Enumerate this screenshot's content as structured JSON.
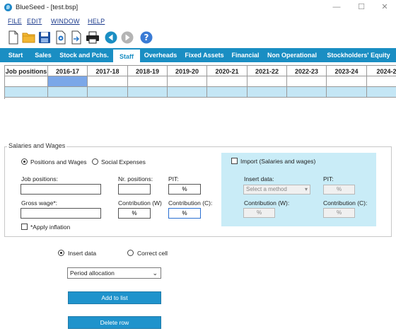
{
  "window": {
    "title": "BlueSeed - [test.bsp]",
    "minimize_icon": "minimize-icon",
    "maximize_icon": "maximize-icon",
    "close_icon": "close-icon"
  },
  "menu": [
    "FILE",
    "EDIT",
    "WINDOW",
    "HELP"
  ],
  "toolbar": {
    "icons": [
      "new-file-icon",
      "open-folder-icon",
      "save-icon",
      "settings-doc-icon",
      "export-icon",
      "print-icon",
      "back-icon",
      "forward-icon",
      "help-icon"
    ]
  },
  "tabs": [
    {
      "label": "Start",
      "active": false
    },
    {
      "label": "Sales",
      "active": false
    },
    {
      "label": "Stock and Pchs.",
      "active": false
    },
    {
      "label": "Staff",
      "active": true
    },
    {
      "label": "Overheads",
      "active": false
    },
    {
      "label": "Fixed Assets",
      "active": false
    },
    {
      "label": "Financial",
      "active": false
    },
    {
      "label": "Non Operational",
      "active": false
    },
    {
      "label": "Stockholders' Equity",
      "active": false
    }
  ],
  "grid": {
    "columns": [
      "Job positions",
      "2016-17",
      "2017-18",
      "2018-19",
      "2019-20",
      "2020-21",
      "2021-22",
      "2022-23",
      "2023-24",
      "2024-2"
    ],
    "selected_cell_color": "#7ba7e8",
    "row_highlight_color": "#c4e6f5"
  },
  "salaries": {
    "legend": "Salaries and Wages",
    "radio_positions": "Positions and Wages",
    "radio_social": "Social Expenses",
    "radio_positions_selected": true,
    "job_positions_label": "Job positions:",
    "nr_positions_label": "Nr. positions:",
    "pit_label": "PIT:",
    "pit_unit": "%",
    "gross_wage_label": "Gross wage*:",
    "contribution_w_label": "Contribution (W)",
    "contribution_w_unit": "%",
    "contribution_c_label": "Contribution (C):",
    "contribution_c_unit": "%",
    "apply_inflation_label": "*Apply inflation",
    "apply_inflation_checked": false
  },
  "import": {
    "checkbox_label": "Import (Salaries and wages)",
    "checked": false,
    "panel_color": "#c9ecf7",
    "insert_data_label": "Insert data:",
    "select_placeholder": "Select a method",
    "pit_label": "PIT:",
    "pit_unit": "%",
    "contribution_w_label": "Contribution (W):",
    "contribution_w_unit": "%",
    "contribution_c_label": "Contribution (C):",
    "contribution_c_unit": "%"
  },
  "bottom": {
    "radio_insert": "Insert data",
    "radio_correct": "Correct cell",
    "radio_insert_selected": true,
    "period_select": "Period allocation",
    "add_button": "Add to list",
    "delete_button": "Delete row",
    "button_color": "#1f93cc"
  }
}
